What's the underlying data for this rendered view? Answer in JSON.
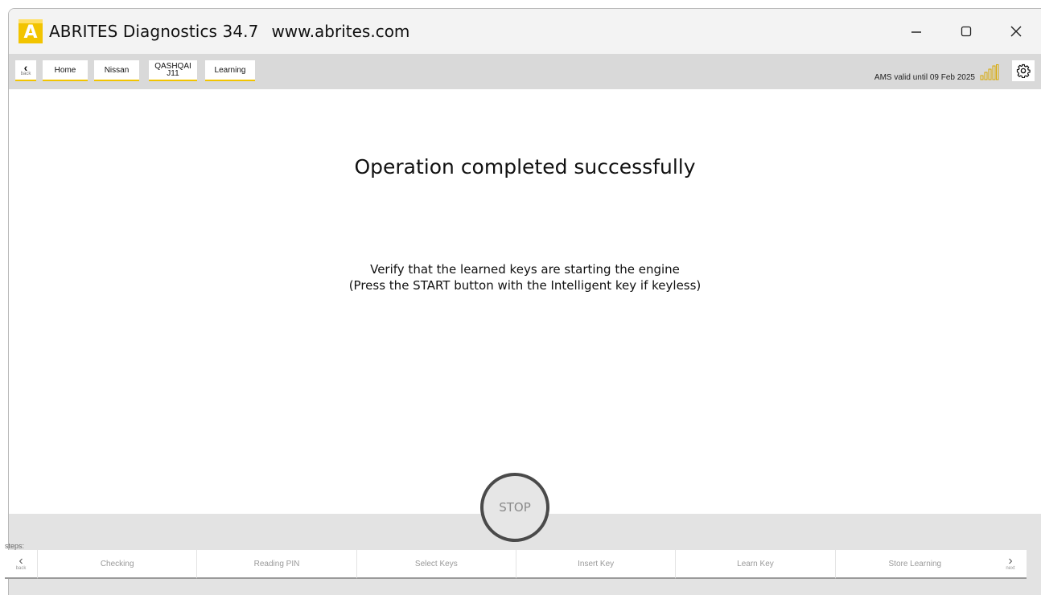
{
  "window": {
    "logo_letter": "A",
    "title": "ABRITES Diagnostics 34.7",
    "url": "www.abrites.com"
  },
  "toolbar": {
    "back_label": "back",
    "breadcrumbs": [
      {
        "label": "Home"
      },
      {
        "label": "Nissan"
      },
      {
        "label": "QASHQAI",
        "sublabel": "J11"
      },
      {
        "label": "Learning"
      }
    ],
    "ams_status": "AMS valid until 09 Feb 2025"
  },
  "main": {
    "title": "Operation completed successfully",
    "message_line1": "Verify that the learned keys are starting the engine",
    "message_line2": "(Press the START button with the Intelligent key if keyless)"
  },
  "stop_label": "STOP",
  "steps": {
    "label": "steps:",
    "back_label": "back",
    "next_label": "next",
    "items": [
      {
        "label": "Checking"
      },
      {
        "label": "Reading PIN"
      },
      {
        "label": "Select Keys"
      },
      {
        "label": "Insert Key"
      },
      {
        "label": "Learn Key"
      },
      {
        "label": "Store Learning"
      }
    ]
  },
  "colors": {
    "accent": "#f2c400",
    "toolbar_bg": "#d9d9d9",
    "bottom_bg": "#e3e3e3"
  },
  "icons": [
    "abrites-logo-icon",
    "minimize-icon",
    "maximize-icon",
    "close-icon",
    "back-arrow-icon",
    "signal-strength-icon",
    "gear-icon",
    "next-arrow-icon"
  ]
}
